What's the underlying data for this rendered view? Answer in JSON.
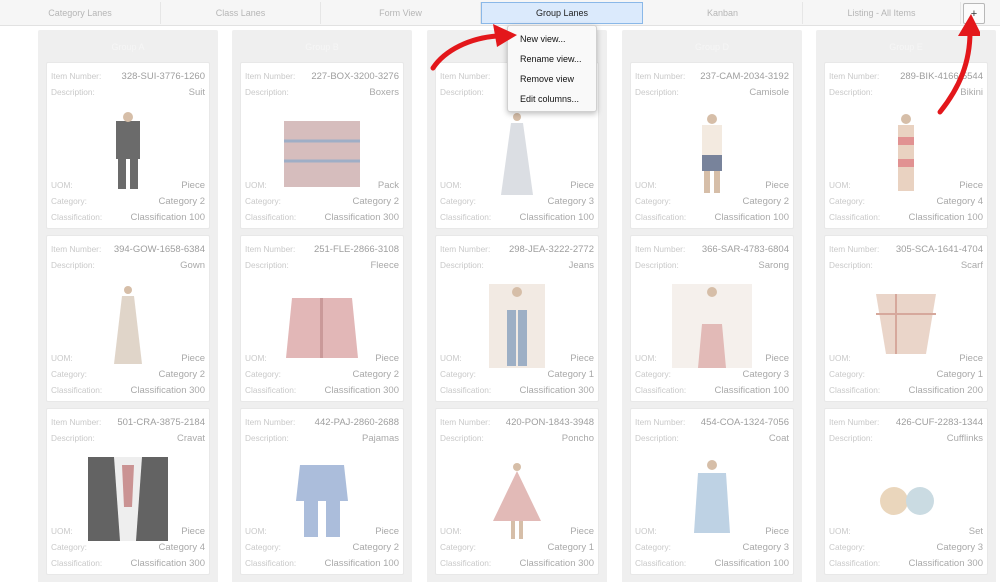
{
  "tabs": [
    {
      "label": "Category Lanes"
    },
    {
      "label": "Class Lanes"
    },
    {
      "label": "Form View"
    },
    {
      "label": "Group Lanes"
    },
    {
      "label": "Kanban"
    },
    {
      "label": "Listing - All Items"
    }
  ],
  "add_view_label": "+",
  "context_menu": {
    "items": [
      "New view...",
      "Rename view...",
      "Remove view",
      "Edit columns..."
    ]
  },
  "field_labels": {
    "item_number": "Item Number:",
    "description": "Description:",
    "uom": "UOM:",
    "category": "Category:",
    "classification": "Classification:"
  },
  "lanes": [
    {
      "name": "Group A",
      "cards": [
        {
          "item_number": "328-SUI-3776-1260",
          "description": "Suit",
          "uom": "Piece",
          "category": "Category 2",
          "classification": "Classification 100",
          "image_icon": "suit-image"
        },
        {
          "item_number": "394-GOW-1658-6384",
          "description": "Gown",
          "uom": "Piece",
          "category": "Category 2",
          "classification": "Classification 300",
          "image_icon": "gown-image"
        },
        {
          "item_number": "501-CRA-3875-2184",
          "description": "Cravat",
          "uom": "Piece",
          "category": "Category 4",
          "classification": "Classification 300",
          "image_icon": "cravat-image"
        }
      ]
    },
    {
      "name": "Group B",
      "cards": [
        {
          "item_number": "227-BOX-3200-3276",
          "description": "Boxers",
          "uom": "Pack",
          "category": "Category 2",
          "classification": "Classification 300",
          "image_icon": "boxers-image"
        },
        {
          "item_number": "251-FLE-2866-3108",
          "description": "Fleece",
          "uom": "Piece",
          "category": "Category 2",
          "classification": "Classification 300",
          "image_icon": "fleece-image"
        },
        {
          "item_number": "442-PAJ-2860-2688",
          "description": "Pajamas",
          "uom": "Piece",
          "category": "Category 2",
          "classification": "Classification 100",
          "image_icon": "pajamas-image"
        }
      ]
    },
    {
      "name": "",
      "cards": [
        {
          "item_number": "",
          "description": "",
          "uom": "Piece",
          "category": "Category 3",
          "classification": "Classification 100",
          "image_icon": "dress-image"
        },
        {
          "item_number": "298-JEA-3222-2772",
          "description": "Jeans",
          "uom": "Piece",
          "category": "Category 1",
          "classification": "Classification 300",
          "image_icon": "jeans-image"
        },
        {
          "item_number": "420-PON-1843-3948",
          "description": "Poncho",
          "uom": "Piece",
          "category": "Category 1",
          "classification": "Classification 300",
          "image_icon": "poncho-image"
        }
      ]
    },
    {
      "name": "Group D",
      "cards": [
        {
          "item_number": "237-CAM-2034-3192",
          "description": "Camisole",
          "uom": "Piece",
          "category": "Category 2",
          "classification": "Classification 100",
          "image_icon": "camisole-image"
        },
        {
          "item_number": "366-SAR-4783-6804",
          "description": "Sarong",
          "uom": "Piece",
          "category": "Category 3",
          "classification": "Classification 100",
          "image_icon": "sarong-image"
        },
        {
          "item_number": "454-COA-1324-7056",
          "description": "Coat",
          "uom": "Piece",
          "category": "Category 3",
          "classification": "Classification 100",
          "image_icon": "coat-image"
        }
      ]
    },
    {
      "name": "Group E",
      "cards": [
        {
          "item_number": "289-BIK-4166-5544",
          "description": "Bikini",
          "uom": "Piece",
          "category": "Category 4",
          "classification": "Classification 100",
          "image_icon": "bikini-image"
        },
        {
          "item_number": "305-SCA-1641-4704",
          "description": "Scarf",
          "uom": "Piece",
          "category": "Category 1",
          "classification": "Classification 200",
          "image_icon": "scarf-image"
        },
        {
          "item_number": "426-CUF-2283-1344",
          "description": "Cufflinks",
          "uom": "Set",
          "category": "Category 3",
          "classification": "Classification 300",
          "image_icon": "cufflinks-image"
        }
      ]
    }
  ],
  "colors": {
    "active_tab_bg": "#dbeafc",
    "active_tab_border": "#8ab8e8",
    "annotation_arrow": "#e3171b"
  }
}
